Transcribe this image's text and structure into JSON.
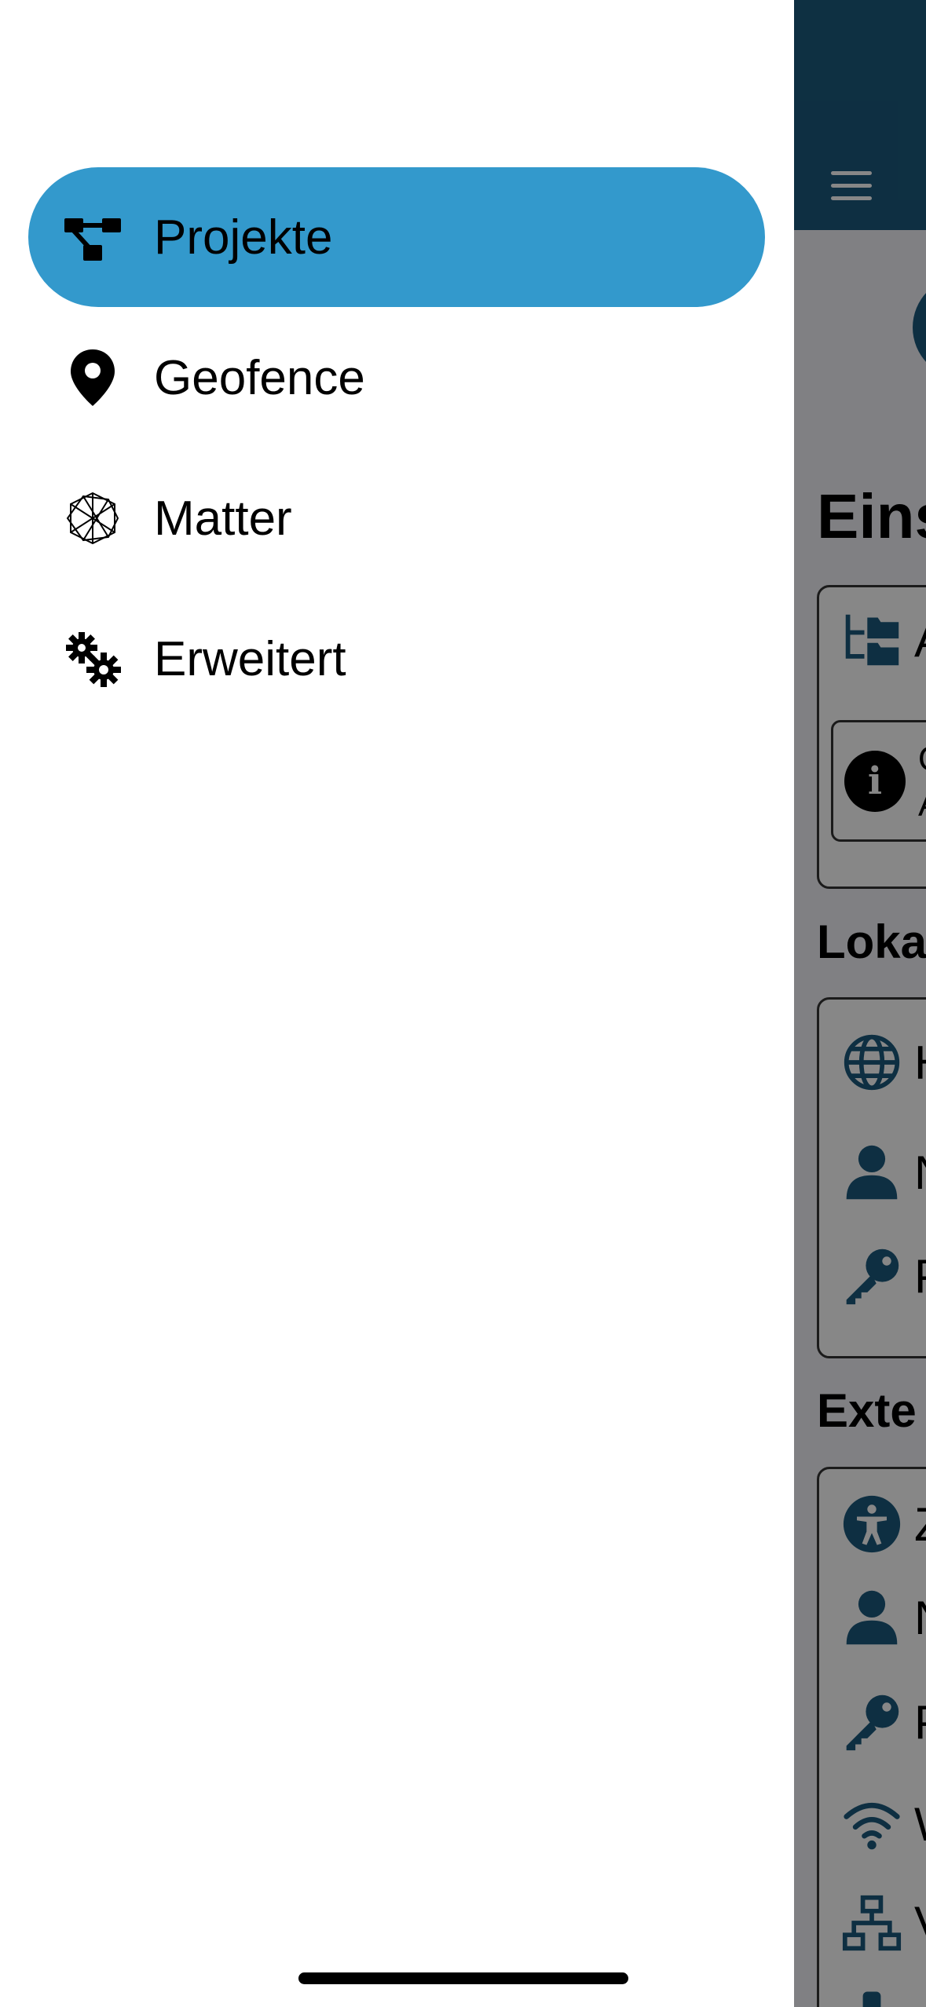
{
  "drawer": {
    "items": [
      {
        "label": "Projekte",
        "icon": "project-diagram-icon",
        "active": true
      },
      {
        "label": "Geofence",
        "icon": "map-pin-icon",
        "active": false
      },
      {
        "label": "Matter",
        "icon": "matter-logo-icon",
        "active": false
      },
      {
        "label": "Erweitert",
        "icon": "gears-icon",
        "active": false
      }
    ]
  },
  "background": {
    "title_fragment": "Eins",
    "info_text_fragment": "Ö\nA",
    "section_local_fragment": "Loka",
    "section_external_fragment": "Exte",
    "card1_row_fragment": "A",
    "local_rows": [
      "H",
      "N",
      "P"
    ],
    "external_rows": [
      "Z",
      "N",
      "P",
      "W",
      "V"
    ]
  },
  "colors": {
    "active_item": "#3399cc",
    "header": "#1b5a7d",
    "icon_blue": "#1b5a7d"
  }
}
